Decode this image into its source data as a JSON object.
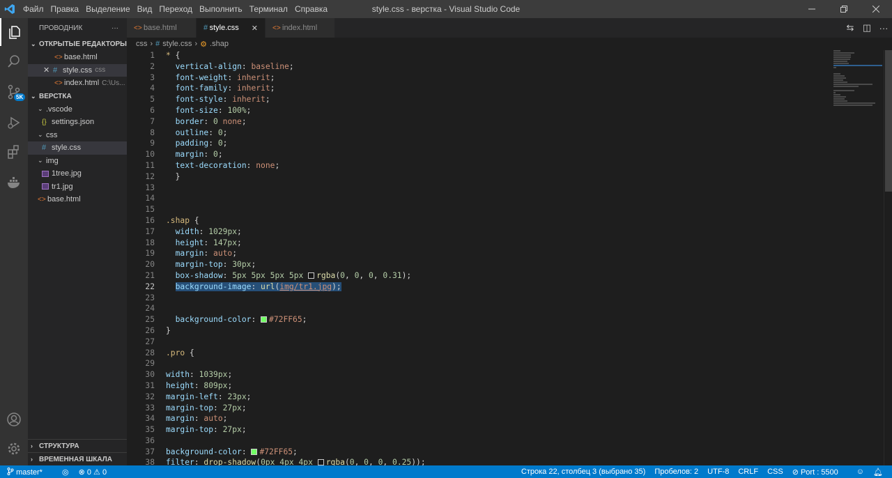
{
  "titlebar": {
    "menu": [
      "Файл",
      "Правка",
      "Выделение",
      "Вид",
      "Переход",
      "Выполнить",
      "Терминал",
      "Справка"
    ],
    "title": "style.css - верстка - Visual Studio Code"
  },
  "activity": {
    "scm_badge": "5K"
  },
  "sidebar": {
    "title": "ПРОВОДНИК",
    "more": "···",
    "open_editors_title": "ОТКРЫТЫЕ РЕДАКТОРЫ",
    "open_editors": [
      {
        "name": "base.html",
        "icon": "html",
        "dir": ""
      },
      {
        "name": "style.css",
        "icon": "css",
        "dir": "css"
      },
      {
        "name": "index.html",
        "icon": "html",
        "dir": "C:\\Us..."
      }
    ],
    "workspace_title": "ВЕРСТКА",
    "tree": {
      "vscode": ".vscode",
      "settings": "settings.json",
      "css": "css",
      "style": "style.css",
      "img": "img",
      "img1": "1tree.jpg",
      "img2": "tr1.jpg",
      "base": "base.html"
    },
    "outline": "СТРУКТУРА",
    "timeline": "ВРЕМЕННАЯ ШКАЛА"
  },
  "tabs": [
    {
      "label": "base.html",
      "icon": "html",
      "active": false
    },
    {
      "label": "style.css",
      "icon": "css",
      "active": true
    },
    {
      "label": "index.html",
      "icon": "html",
      "active": false
    }
  ],
  "breadcrumb": {
    "folder": "css",
    "file": "style.css",
    "symbol": ".shap"
  },
  "editor": {
    "current_line": 22,
    "line_numbers": [
      1,
      2,
      3,
      4,
      5,
      6,
      7,
      8,
      9,
      10,
      11,
      12,
      13,
      14,
      15,
      16,
      17,
      18,
      19,
      20,
      21,
      22,
      23,
      24,
      25,
      26,
      27,
      28,
      29,
      30,
      31,
      32,
      33,
      34,
      35,
      36,
      37,
      38
    ]
  },
  "statusbar": {
    "branch": "master*",
    "errors": "⊗ 0 ⚠ 0",
    "position": "Строка 22, столбец 3 (выбрано 35)",
    "spaces": "Пробелов: 2",
    "encoding": "UTF-8",
    "eol": "CRLF",
    "language": "CSS",
    "port": "Port : 5500"
  }
}
